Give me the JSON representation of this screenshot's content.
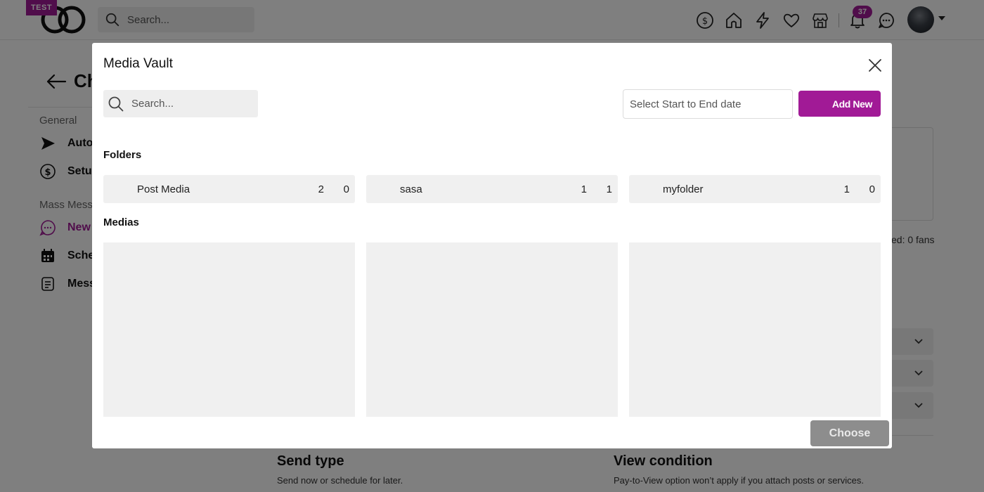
{
  "topbar": {
    "test_badge": "TEST",
    "search_placeholder": "Search...",
    "notification_count": "37"
  },
  "background": {
    "back_title": "Ch",
    "sections": {
      "general": "General",
      "mass_messages": "Mass Mess"
    },
    "items": {
      "auto": "Auto",
      "setup": "Setu",
      "new": "New",
      "schedule": "Sche",
      "messages": "Mess"
    },
    "selected_fans": "ed: 0 fans",
    "send_type": {
      "title": "Send type",
      "subtitle": "Send now or schedule for later."
    },
    "view_condition": {
      "title": "View condition",
      "subtitle": "Pay-to-View option won’t apply if you attach posts or services."
    }
  },
  "modal": {
    "title": "Media Vault",
    "search_placeholder": "Search...",
    "date_placeholder": "Select Start to End date",
    "add_new_label": "Add New",
    "folders_heading": "Folders",
    "folders": [
      {
        "name": "Post Media",
        "count_a": "2",
        "count_b": "0"
      },
      {
        "name": "sasa",
        "count_a": "1",
        "count_b": "1"
      },
      {
        "name": "myfolder",
        "count_a": "1",
        "count_b": "0"
      }
    ],
    "medias_heading": "Medias",
    "choose_label": "Choose"
  },
  "colors": {
    "brand": "#a11a96",
    "overlay": "rgba(0,0,0,0.5)",
    "tile": "#f0f0f0",
    "disabled_button": "#8d8d8d"
  }
}
